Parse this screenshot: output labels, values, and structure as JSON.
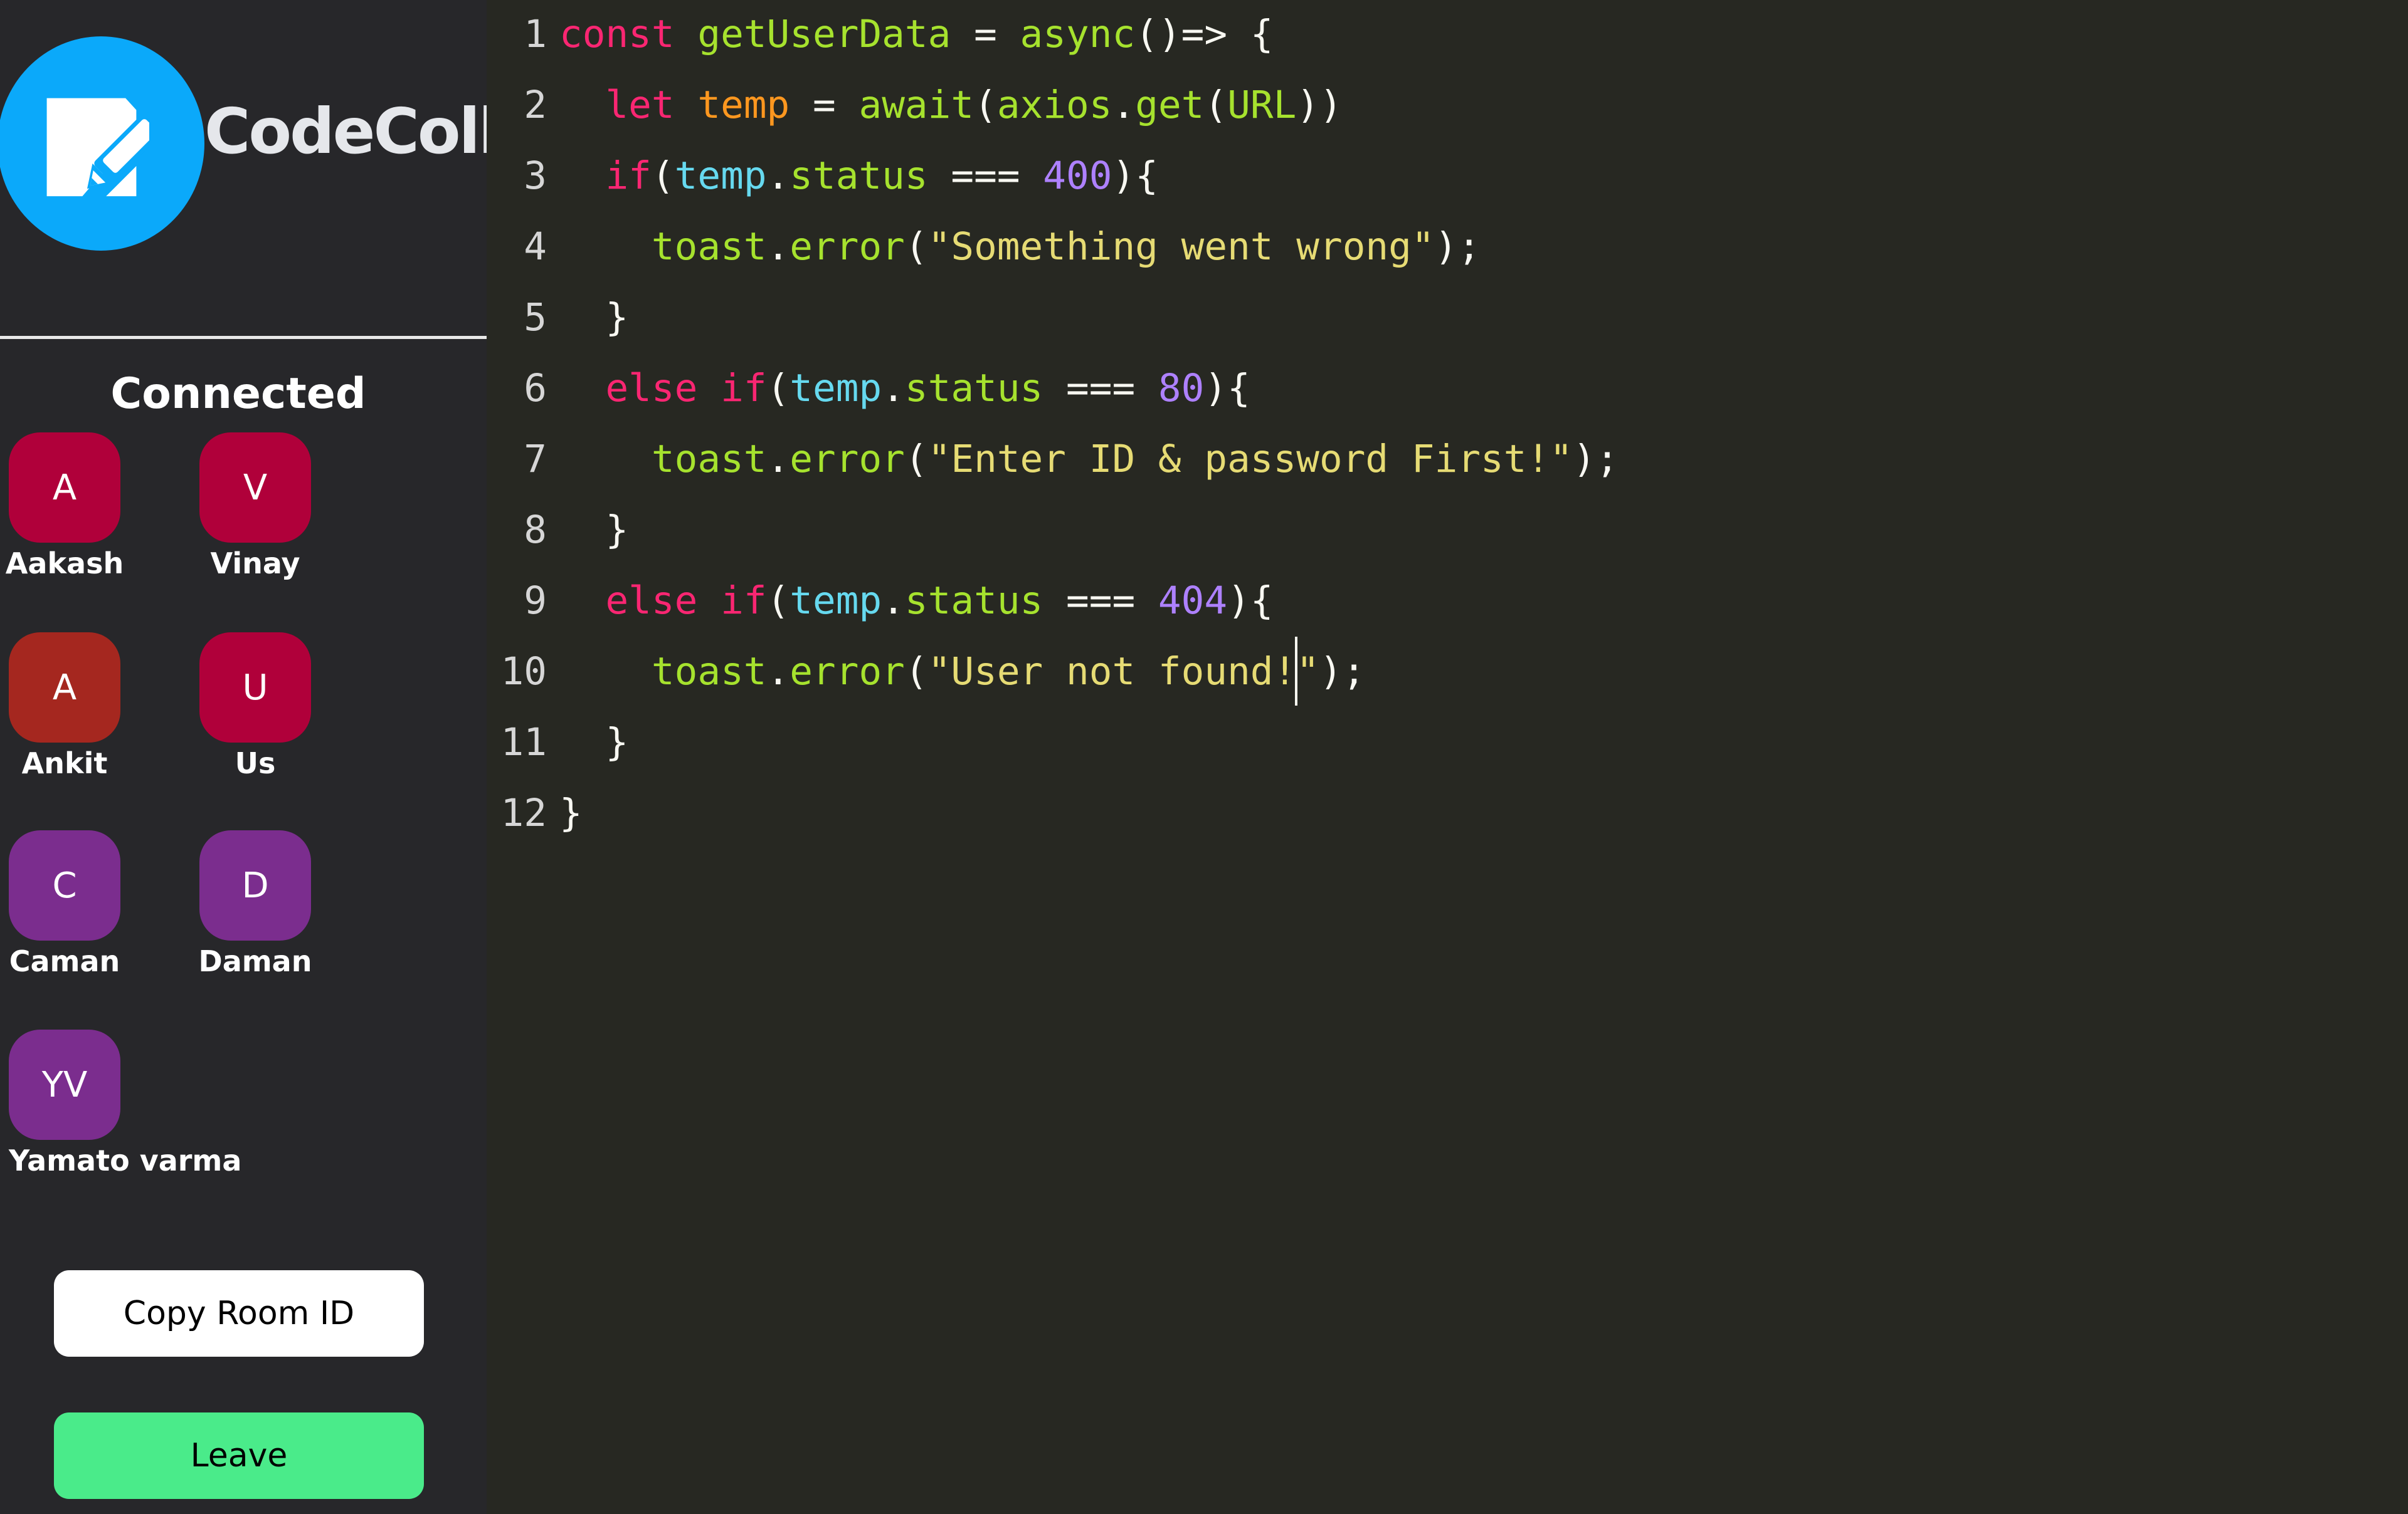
{
  "app": {
    "brand_name": "CodeColl",
    "logo_icon": "edit-document-icon",
    "accent_color": "#0BA9FA"
  },
  "sidebar": {
    "connected_heading": "Connected",
    "members": [
      {
        "initials": "A",
        "name": "Aakash",
        "color": "#B0003A"
      },
      {
        "initials": "V",
        "name": "Vinay",
        "color": "#B0003A"
      },
      {
        "initials": "A",
        "name": "Ankit",
        "color": "#A5271F"
      },
      {
        "initials": "U",
        "name": "Us",
        "color": "#B0003A"
      },
      {
        "initials": "C",
        "name": "Caman",
        "color": "#7B2D8E"
      },
      {
        "initials": "D",
        "name": "Daman",
        "color": "#7B2D8E"
      },
      {
        "initials": "YV",
        "name": "Yamato varma",
        "color": "#7B2D8E"
      }
    ],
    "copy_room_id_label": "Copy Room ID",
    "leave_label": "Leave",
    "leave_color": "#4AEB8A"
  },
  "editor": {
    "theme": "monokai",
    "cursor": {
      "line": 10,
      "after_text": "toast.error(\"User not found!"
    },
    "lines": [
      {
        "number": "1",
        "tokens": [
          [
            "k",
            "const"
          ],
          [
            "o",
            " "
          ],
          [
            "f",
            "getUserData"
          ],
          [
            "o",
            " = "
          ],
          [
            "f",
            "async"
          ],
          [
            "o",
            "()=> {"
          ]
        ]
      },
      {
        "number": "2",
        "tokens": [
          [
            "o",
            "  "
          ],
          [
            "k",
            "let"
          ],
          [
            "o",
            " "
          ],
          [
            "v",
            "temp"
          ],
          [
            "o",
            " = "
          ],
          [
            "f",
            "await"
          ],
          [
            "o",
            "("
          ],
          [
            "f",
            "axios"
          ],
          [
            "o",
            "."
          ],
          [
            "f",
            "get"
          ],
          [
            "o",
            "("
          ],
          [
            "f",
            "URL"
          ],
          [
            "o",
            "))"
          ]
        ]
      },
      {
        "number": "3",
        "tokens": [
          [
            "o",
            "  "
          ],
          [
            "k",
            "if"
          ],
          [
            "o",
            "("
          ],
          [
            "p",
            "temp"
          ],
          [
            "o",
            "."
          ],
          [
            "f",
            "status"
          ],
          [
            "o",
            " === "
          ],
          [
            "n",
            "400"
          ],
          [
            "o",
            "){"
          ]
        ]
      },
      {
        "number": "4",
        "tokens": [
          [
            "o",
            "    "
          ],
          [
            "f",
            "toast"
          ],
          [
            "o",
            "."
          ],
          [
            "f",
            "error"
          ],
          [
            "o",
            "("
          ],
          [
            "s",
            "\"Something went wrong\""
          ],
          [
            "o",
            ");"
          ]
        ]
      },
      {
        "number": "5",
        "tokens": [
          [
            "o",
            "  }"
          ]
        ]
      },
      {
        "number": "6",
        "tokens": [
          [
            "o",
            "  "
          ],
          [
            "k",
            "else"
          ],
          [
            "o",
            " "
          ],
          [
            "k",
            "if"
          ],
          [
            "o",
            "("
          ],
          [
            "p",
            "temp"
          ],
          [
            "o",
            "."
          ],
          [
            "f",
            "status"
          ],
          [
            "o",
            " === "
          ],
          [
            "n",
            "80"
          ],
          [
            "o",
            "){"
          ]
        ]
      },
      {
        "number": "7",
        "tokens": [
          [
            "o",
            "    "
          ],
          [
            "f",
            "toast"
          ],
          [
            "o",
            "."
          ],
          [
            "f",
            "error"
          ],
          [
            "o",
            "("
          ],
          [
            "s",
            "\"Enter ID & password First!\""
          ],
          [
            "o",
            ");"
          ]
        ]
      },
      {
        "number": "8",
        "tokens": [
          [
            "o",
            "  }"
          ]
        ]
      },
      {
        "number": "9",
        "tokens": [
          [
            "o",
            "  "
          ],
          [
            "k",
            "else"
          ],
          [
            "o",
            " "
          ],
          [
            "k",
            "if"
          ],
          [
            "o",
            "("
          ],
          [
            "p",
            "temp"
          ],
          [
            "o",
            "."
          ],
          [
            "f",
            "status"
          ],
          [
            "o",
            " === "
          ],
          [
            "n",
            "404"
          ],
          [
            "o",
            "){"
          ]
        ]
      },
      {
        "number": "10",
        "tokens": [
          [
            "o",
            "    "
          ],
          [
            "f",
            "toast"
          ],
          [
            "o",
            "."
          ],
          [
            "f",
            "error"
          ],
          [
            "o",
            "("
          ],
          [
            "s",
            "\"User not found!"
          ],
          [
            "cursor",
            ""
          ],
          [
            "s",
            "\""
          ],
          [
            "o",
            ");"
          ]
        ]
      },
      {
        "number": "11",
        "tokens": [
          [
            "o",
            "  }"
          ]
        ]
      },
      {
        "number": "12",
        "tokens": [
          [
            "o",
            "}"
          ]
        ]
      }
    ]
  }
}
